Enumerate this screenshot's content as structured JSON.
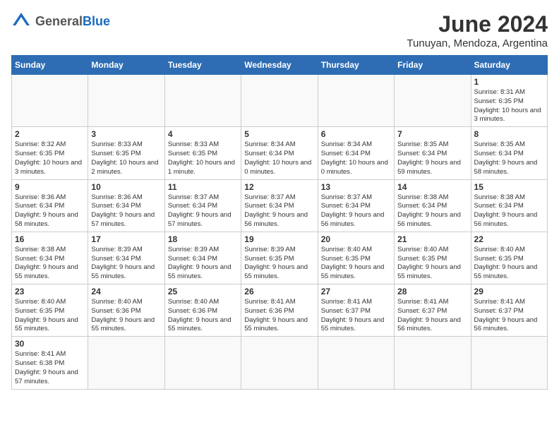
{
  "header": {
    "logo_general": "General",
    "logo_blue": "Blue",
    "month_year": "June 2024",
    "location": "Tunuyan, Mendoza, Argentina"
  },
  "days_of_week": [
    "Sunday",
    "Monday",
    "Tuesday",
    "Wednesday",
    "Thursday",
    "Friday",
    "Saturday"
  ],
  "weeks": [
    [
      {
        "day": "",
        "info": ""
      },
      {
        "day": "",
        "info": ""
      },
      {
        "day": "",
        "info": ""
      },
      {
        "day": "",
        "info": ""
      },
      {
        "day": "",
        "info": ""
      },
      {
        "day": "",
        "info": ""
      },
      {
        "day": "1",
        "info": "Sunrise: 8:31 AM\nSunset: 6:35 PM\nDaylight: 10 hours and 3 minutes."
      }
    ],
    [
      {
        "day": "2",
        "info": "Sunrise: 8:32 AM\nSunset: 6:35 PM\nDaylight: 10 hours and 3 minutes."
      },
      {
        "day": "3",
        "info": "Sunrise: 8:33 AM\nSunset: 6:35 PM\nDaylight: 10 hours and 2 minutes."
      },
      {
        "day": "4",
        "info": "Sunrise: 8:33 AM\nSunset: 6:35 PM\nDaylight: 10 hours and 1 minute."
      },
      {
        "day": "5",
        "info": "Sunrise: 8:34 AM\nSunset: 6:34 PM\nDaylight: 10 hours and 0 minutes."
      },
      {
        "day": "6",
        "info": "Sunrise: 8:34 AM\nSunset: 6:34 PM\nDaylight: 10 hours and 0 minutes."
      },
      {
        "day": "7",
        "info": "Sunrise: 8:35 AM\nSunset: 6:34 PM\nDaylight: 9 hours and 59 minutes."
      },
      {
        "day": "8",
        "info": "Sunrise: 8:35 AM\nSunset: 6:34 PM\nDaylight: 9 hours and 58 minutes."
      }
    ],
    [
      {
        "day": "9",
        "info": "Sunrise: 8:36 AM\nSunset: 6:34 PM\nDaylight: 9 hours and 58 minutes."
      },
      {
        "day": "10",
        "info": "Sunrise: 8:36 AM\nSunset: 6:34 PM\nDaylight: 9 hours and 57 minutes."
      },
      {
        "day": "11",
        "info": "Sunrise: 8:37 AM\nSunset: 6:34 PM\nDaylight: 9 hours and 57 minutes."
      },
      {
        "day": "12",
        "info": "Sunrise: 8:37 AM\nSunset: 6:34 PM\nDaylight: 9 hours and 56 minutes."
      },
      {
        "day": "13",
        "info": "Sunrise: 8:37 AM\nSunset: 6:34 PM\nDaylight: 9 hours and 56 minutes."
      },
      {
        "day": "14",
        "info": "Sunrise: 8:38 AM\nSunset: 6:34 PM\nDaylight: 9 hours and 56 minutes."
      },
      {
        "day": "15",
        "info": "Sunrise: 8:38 AM\nSunset: 6:34 PM\nDaylight: 9 hours and 56 minutes."
      }
    ],
    [
      {
        "day": "16",
        "info": "Sunrise: 8:38 AM\nSunset: 6:34 PM\nDaylight: 9 hours and 55 minutes."
      },
      {
        "day": "17",
        "info": "Sunrise: 8:39 AM\nSunset: 6:34 PM\nDaylight: 9 hours and 55 minutes."
      },
      {
        "day": "18",
        "info": "Sunrise: 8:39 AM\nSunset: 6:34 PM\nDaylight: 9 hours and 55 minutes."
      },
      {
        "day": "19",
        "info": "Sunrise: 8:39 AM\nSunset: 6:35 PM\nDaylight: 9 hours and 55 minutes."
      },
      {
        "day": "20",
        "info": "Sunrise: 8:40 AM\nSunset: 6:35 PM\nDaylight: 9 hours and 55 minutes."
      },
      {
        "day": "21",
        "info": "Sunrise: 8:40 AM\nSunset: 6:35 PM\nDaylight: 9 hours and 55 minutes."
      },
      {
        "day": "22",
        "info": "Sunrise: 8:40 AM\nSunset: 6:35 PM\nDaylight: 9 hours and 55 minutes."
      }
    ],
    [
      {
        "day": "23",
        "info": "Sunrise: 8:40 AM\nSunset: 6:35 PM\nDaylight: 9 hours and 55 minutes."
      },
      {
        "day": "24",
        "info": "Sunrise: 8:40 AM\nSunset: 6:36 PM\nDaylight: 9 hours and 55 minutes."
      },
      {
        "day": "25",
        "info": "Sunrise: 8:40 AM\nSunset: 6:36 PM\nDaylight: 9 hours and 55 minutes."
      },
      {
        "day": "26",
        "info": "Sunrise: 8:41 AM\nSunset: 6:36 PM\nDaylight: 9 hours and 55 minutes."
      },
      {
        "day": "27",
        "info": "Sunrise: 8:41 AM\nSunset: 6:37 PM\nDaylight: 9 hours and 55 minutes."
      },
      {
        "day": "28",
        "info": "Sunrise: 8:41 AM\nSunset: 6:37 PM\nDaylight: 9 hours and 56 minutes."
      },
      {
        "day": "29",
        "info": "Sunrise: 8:41 AM\nSunset: 6:37 PM\nDaylight: 9 hours and 56 minutes."
      }
    ],
    [
      {
        "day": "30",
        "info": "Sunrise: 8:41 AM\nSunset: 6:38 PM\nDaylight: 9 hours and 57 minutes."
      },
      {
        "day": "",
        "info": ""
      },
      {
        "day": "",
        "info": ""
      },
      {
        "day": "",
        "info": ""
      },
      {
        "day": "",
        "info": ""
      },
      {
        "day": "",
        "info": ""
      },
      {
        "day": "",
        "info": ""
      }
    ]
  ]
}
